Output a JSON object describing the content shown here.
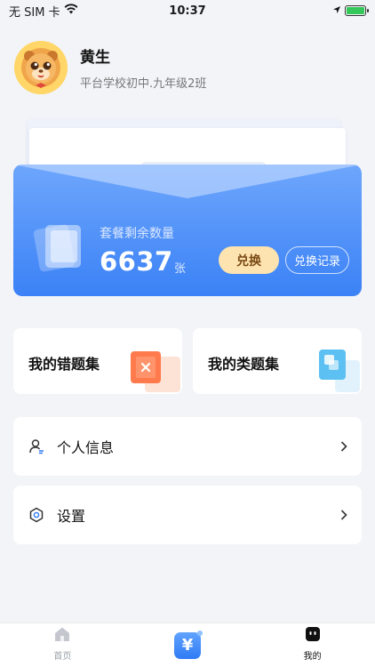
{
  "status_bar": {
    "carrier": "无 SIM 卡",
    "time": "10:37"
  },
  "profile": {
    "name": "黄生",
    "school": "平台学校初中.九年级2班"
  },
  "package_card": {
    "label": "套餐剩余数量",
    "count": "6637",
    "unit": "张",
    "exchange_button": "兑换",
    "record_button": "兑换记录",
    "accent_color": "#3b82f6"
  },
  "tiles": [
    {
      "label": "我的错题集",
      "icon": "wrong-questions-icon"
    },
    {
      "label": "我的类题集",
      "icon": "similar-questions-icon"
    }
  ],
  "menu": [
    {
      "label": "个人信息",
      "icon": "user-icon"
    },
    {
      "label": "设置",
      "icon": "settings-icon"
    }
  ],
  "tabbar": {
    "items": [
      {
        "label": "首页",
        "icon": "home-icon",
        "active": false
      },
      {
        "label": "",
        "icon": "yen-icon",
        "active": false
      },
      {
        "label": "我的",
        "icon": "robot-face-icon",
        "active": true
      }
    ]
  }
}
